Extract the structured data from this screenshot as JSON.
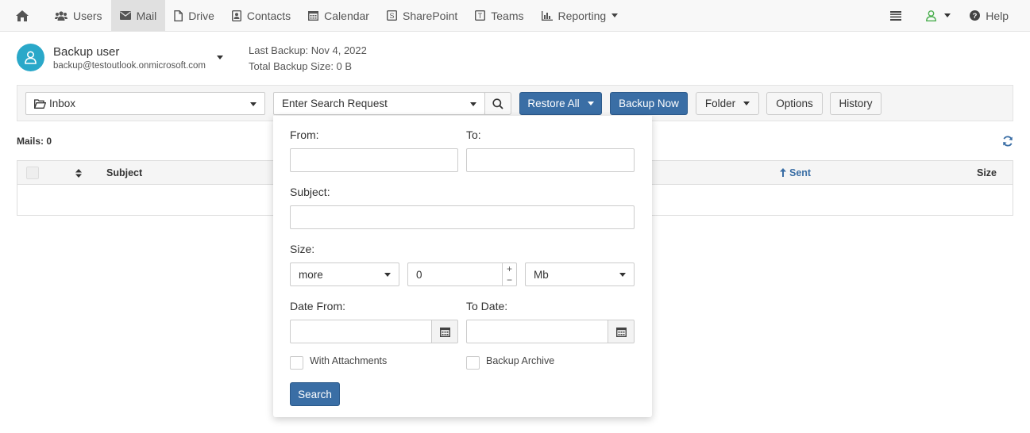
{
  "nav": {
    "items": [
      {
        "label": "Users",
        "icon": "users-icon"
      },
      {
        "label": "Mail",
        "icon": "envelope-icon"
      },
      {
        "label": "Drive",
        "icon": "file-icon"
      },
      {
        "label": "Contacts",
        "icon": "contact-card-icon"
      },
      {
        "label": "Calendar",
        "icon": "calendar-icon"
      },
      {
        "label": "SharePoint",
        "icon": "sharepoint-icon"
      },
      {
        "label": "Teams",
        "icon": "teams-icon"
      },
      {
        "label": "Reporting",
        "icon": "bar-chart-icon"
      }
    ],
    "active": "Mail",
    "sharepoint_glyph": "S",
    "teams_glyph": "T",
    "help_label": "Help"
  },
  "user": {
    "name": "Backup user",
    "email": "backup@testoutlook.onmicrosoft.com",
    "last_backup": "Last Backup: Nov 4, 2022",
    "total_size": "Total Backup Size: 0 B"
  },
  "toolbar": {
    "folder_value": "Inbox",
    "search_placeholder": "Enter Search Request",
    "restore_all": "Restore All",
    "backup_now": "Backup Now",
    "folder": "Folder",
    "options": "Options",
    "history": "History"
  },
  "mails_count": "Mails: 0",
  "table": {
    "columns": {
      "subject": "Subject",
      "sent": "Sent",
      "size": "Size"
    }
  },
  "search_panel": {
    "from_label": "From:",
    "to_label": "To:",
    "subject_label": "Subject:",
    "size_label": "Size:",
    "size_compare": "more",
    "size_value": "0",
    "size_unit": "Mb",
    "stepper_plus": "+",
    "stepper_minus": "−",
    "date_from_label": "Date From:",
    "to_date_label": "To Date:",
    "with_attachments": "With Attachments",
    "backup_archive": "Backup Archive",
    "search_button": "Search"
  },
  "colors": {
    "primary": "#3a6ea5",
    "avatar": "#2aa8c9",
    "user_icon": "#4caf50"
  }
}
